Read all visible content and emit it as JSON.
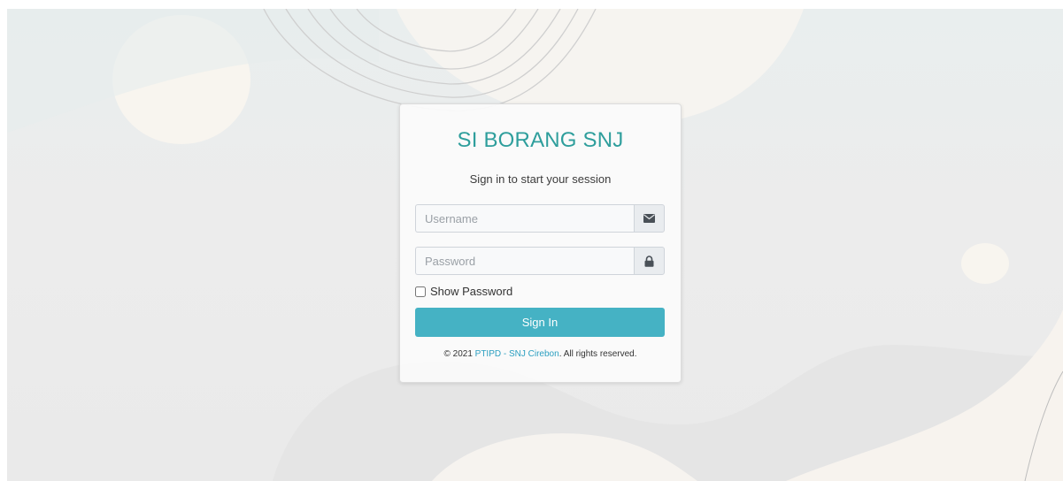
{
  "login": {
    "title": "SI BORANG SNJ",
    "subtitle": "Sign in to start your session",
    "username": {
      "placeholder": "Username",
      "value": "",
      "icon": "envelope-icon"
    },
    "password": {
      "placeholder": "Password",
      "value": "",
      "icon": "lock-icon"
    },
    "show_password_label": "Show Password",
    "show_password_checked": false,
    "submit_label": "Sign In"
  },
  "footer": {
    "prefix": "© 2021 ",
    "link_text": "PTIPD - SNJ Cirebon",
    "suffix": ". All rights reserved."
  },
  "colors": {
    "title": "#2e9e9c",
    "button": "#45b2c4",
    "link": "#2b9fc0",
    "background": "#ececec"
  }
}
